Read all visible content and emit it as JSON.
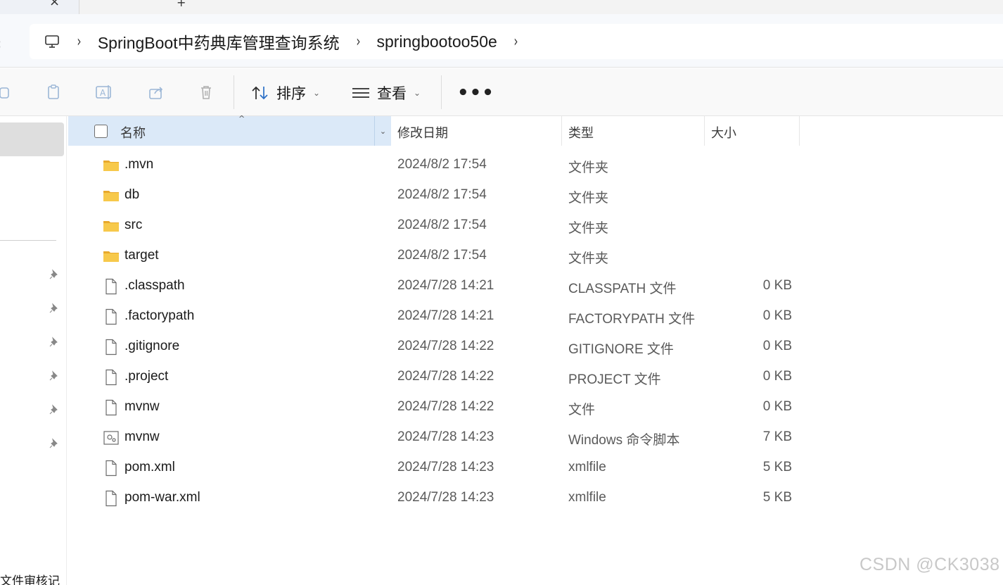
{
  "window": {
    "tab_close_glyph": "×",
    "tab_new_glyph": "+"
  },
  "address_bar": {
    "back_glyph": "‹",
    "breadcrumb": [
      "SpringBoot中药典库管理查询系统",
      "springbootoo50e"
    ],
    "separator": "›"
  },
  "toolbar": {
    "sort_label": "排序",
    "view_label": "查看",
    "more_label": "•••"
  },
  "nav_pane": {
    "bottom_label": "文件审核记"
  },
  "columns": {
    "name": "名称",
    "date": "修改日期",
    "type": "类型",
    "size": "大小"
  },
  "files": [
    {
      "name": ".mvn",
      "date": "2024/8/2 17:54",
      "type": "文件夹",
      "size": "",
      "icon": "folder-icon"
    },
    {
      "name": "db",
      "date": "2024/8/2 17:54",
      "type": "文件夹",
      "size": "",
      "icon": "folder-icon"
    },
    {
      "name": "src",
      "date": "2024/8/2 17:54",
      "type": "文件夹",
      "size": "",
      "icon": "folder-icon"
    },
    {
      "name": "target",
      "date": "2024/8/2 17:54",
      "type": "文件夹",
      "size": "",
      "icon": "folder-icon"
    },
    {
      "name": ".classpath",
      "date": "2024/7/28 14:21",
      "type": "CLASSPATH 文件",
      "size": "0 KB",
      "icon": "file-icon"
    },
    {
      "name": ".factorypath",
      "date": "2024/7/28 14:21",
      "type": "FACTORYPATH 文件",
      "size": "0 KB",
      "icon": "file-icon"
    },
    {
      "name": ".gitignore",
      "date": "2024/7/28 14:22",
      "type": "GITIGNORE 文件",
      "size": "0 KB",
      "icon": "file-icon"
    },
    {
      "name": ".project",
      "date": "2024/7/28 14:22",
      "type": "PROJECT 文件",
      "size": "0 KB",
      "icon": "file-icon"
    },
    {
      "name": "mvnw",
      "date": "2024/7/28 14:22",
      "type": "文件",
      "size": "0 KB",
      "icon": "file-icon"
    },
    {
      "name": "mvnw",
      "date": "2024/7/28 14:23",
      "type": "Windows 命令脚本",
      "size": "7 KB",
      "icon": "script-file-icon"
    },
    {
      "name": "pom.xml",
      "date": "2024/7/28 14:23",
      "type": "xmlfile",
      "size": "5 KB",
      "icon": "file-icon"
    },
    {
      "name": "pom-war.xml",
      "date": "2024/7/28 14:23",
      "type": "xmlfile",
      "size": "5 KB",
      "icon": "file-icon"
    }
  ],
  "watermark": "CSDN @CK3038",
  "colors": {
    "folder": "#f4c245",
    "header_selected": "#dbe9f8",
    "nav_selected": "#dedede"
  }
}
